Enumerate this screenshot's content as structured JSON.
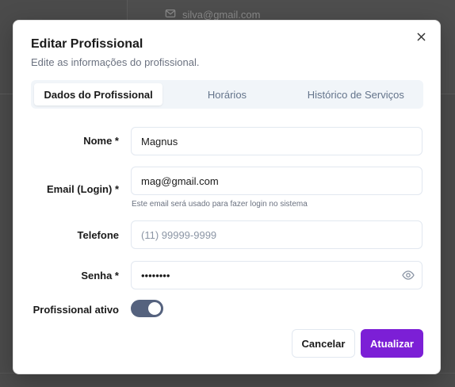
{
  "background": {
    "email": "silva@gmail.com"
  },
  "modal": {
    "title": "Editar Profissional",
    "subtitle": "Edite as informações do profissional.",
    "tabs": [
      {
        "label": "Dados do Profissional",
        "active": true
      },
      {
        "label": "Horários",
        "active": false
      },
      {
        "label": "Histórico de Serviços",
        "active": false
      }
    ],
    "form": {
      "nome": {
        "label": "Nome *",
        "value": "Magnus"
      },
      "email": {
        "label": "Email (Login) *",
        "value": "mag@gmail.com",
        "hint": "Este email será usado para fazer login no sistema"
      },
      "telefone": {
        "label": "Telefone",
        "value": "",
        "placeholder": "(11) 99999-9999"
      },
      "senha": {
        "label": "Senha *",
        "value": "••••••••"
      },
      "ativo": {
        "label": "Profissional ativo",
        "checked": true
      }
    },
    "buttons": {
      "cancel": "Cancelar",
      "submit": "Atualizar"
    }
  },
  "colors": {
    "primary": "#7c1fd6",
    "toggle_on": "#55627e"
  }
}
